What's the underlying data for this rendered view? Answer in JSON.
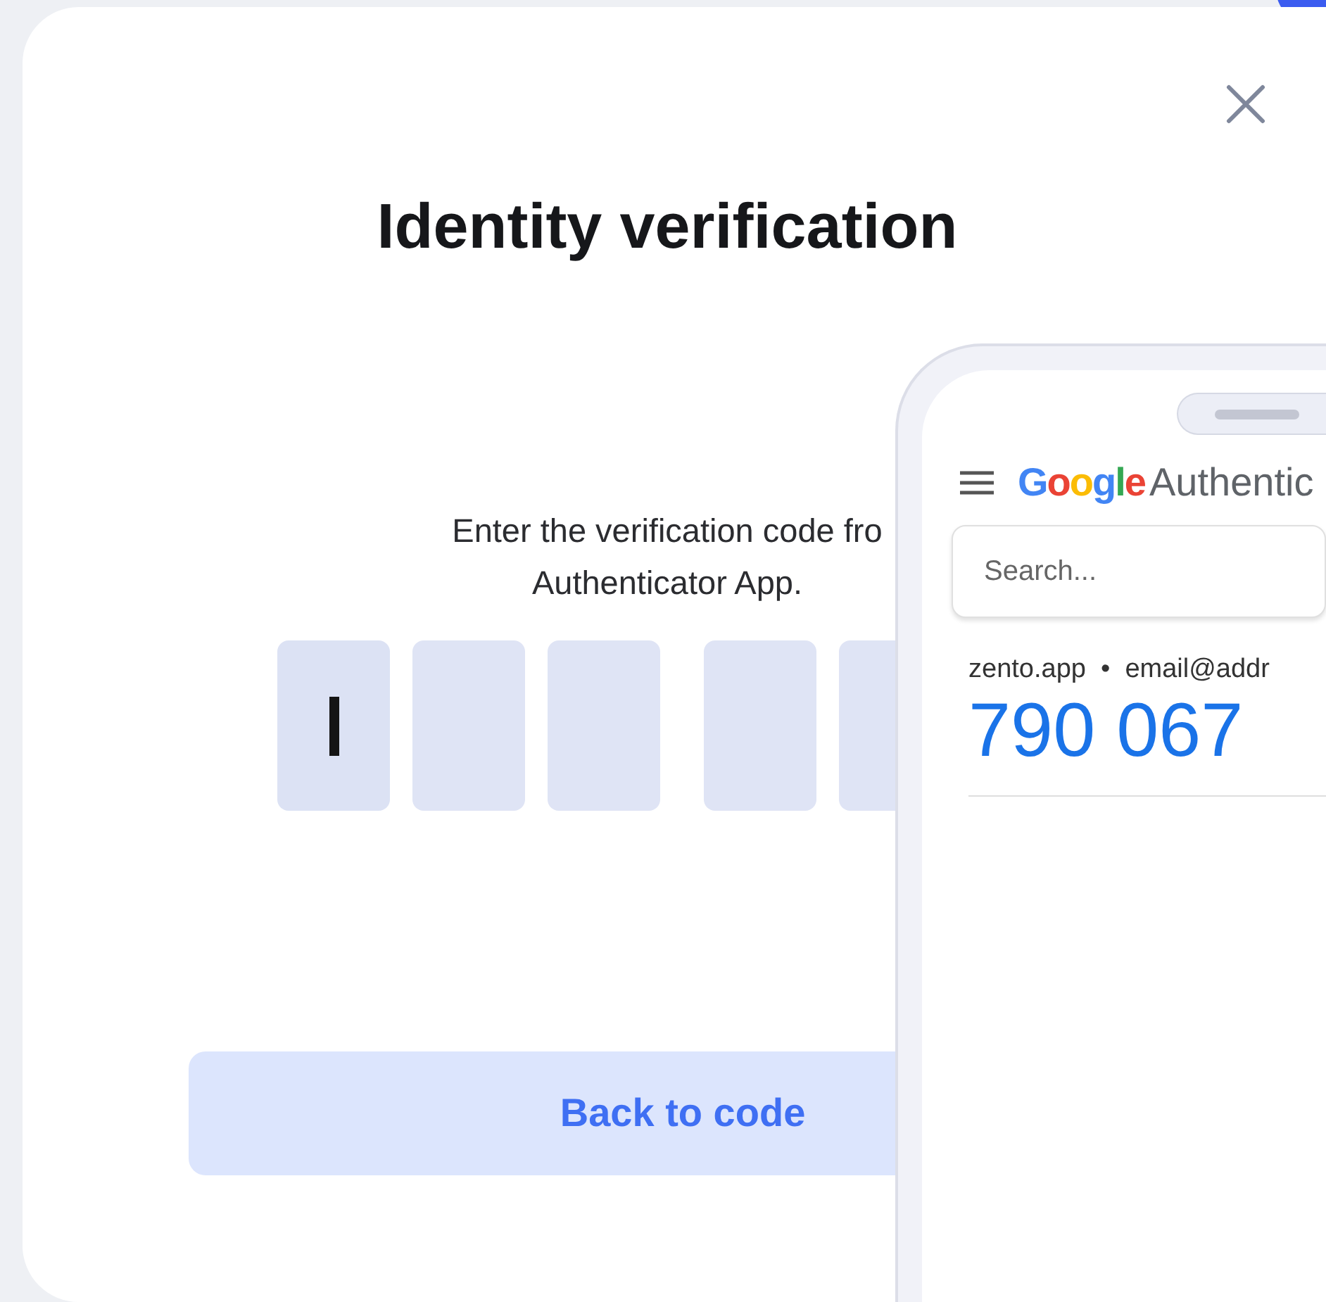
{
  "dialog": {
    "title": "Identity verification",
    "instruction_lines": [
      "Enter the verification code fro",
      "Authenticator App."
    ],
    "code_boxes": [
      {
        "focused": true
      },
      {
        "focused": false
      },
      {
        "focused": false
      },
      {
        "focused": false
      },
      {
        "focused": false
      }
    ],
    "button": "Back to code"
  },
  "phone": {
    "app_brand": "Google",
    "app_name": "Authentic",
    "search": {
      "placeholder": "Search..."
    },
    "accounts": [
      {
        "issuer": "zento.app",
        "separator": "•",
        "account": "email@addr",
        "code": "790 067"
      }
    ]
  }
}
